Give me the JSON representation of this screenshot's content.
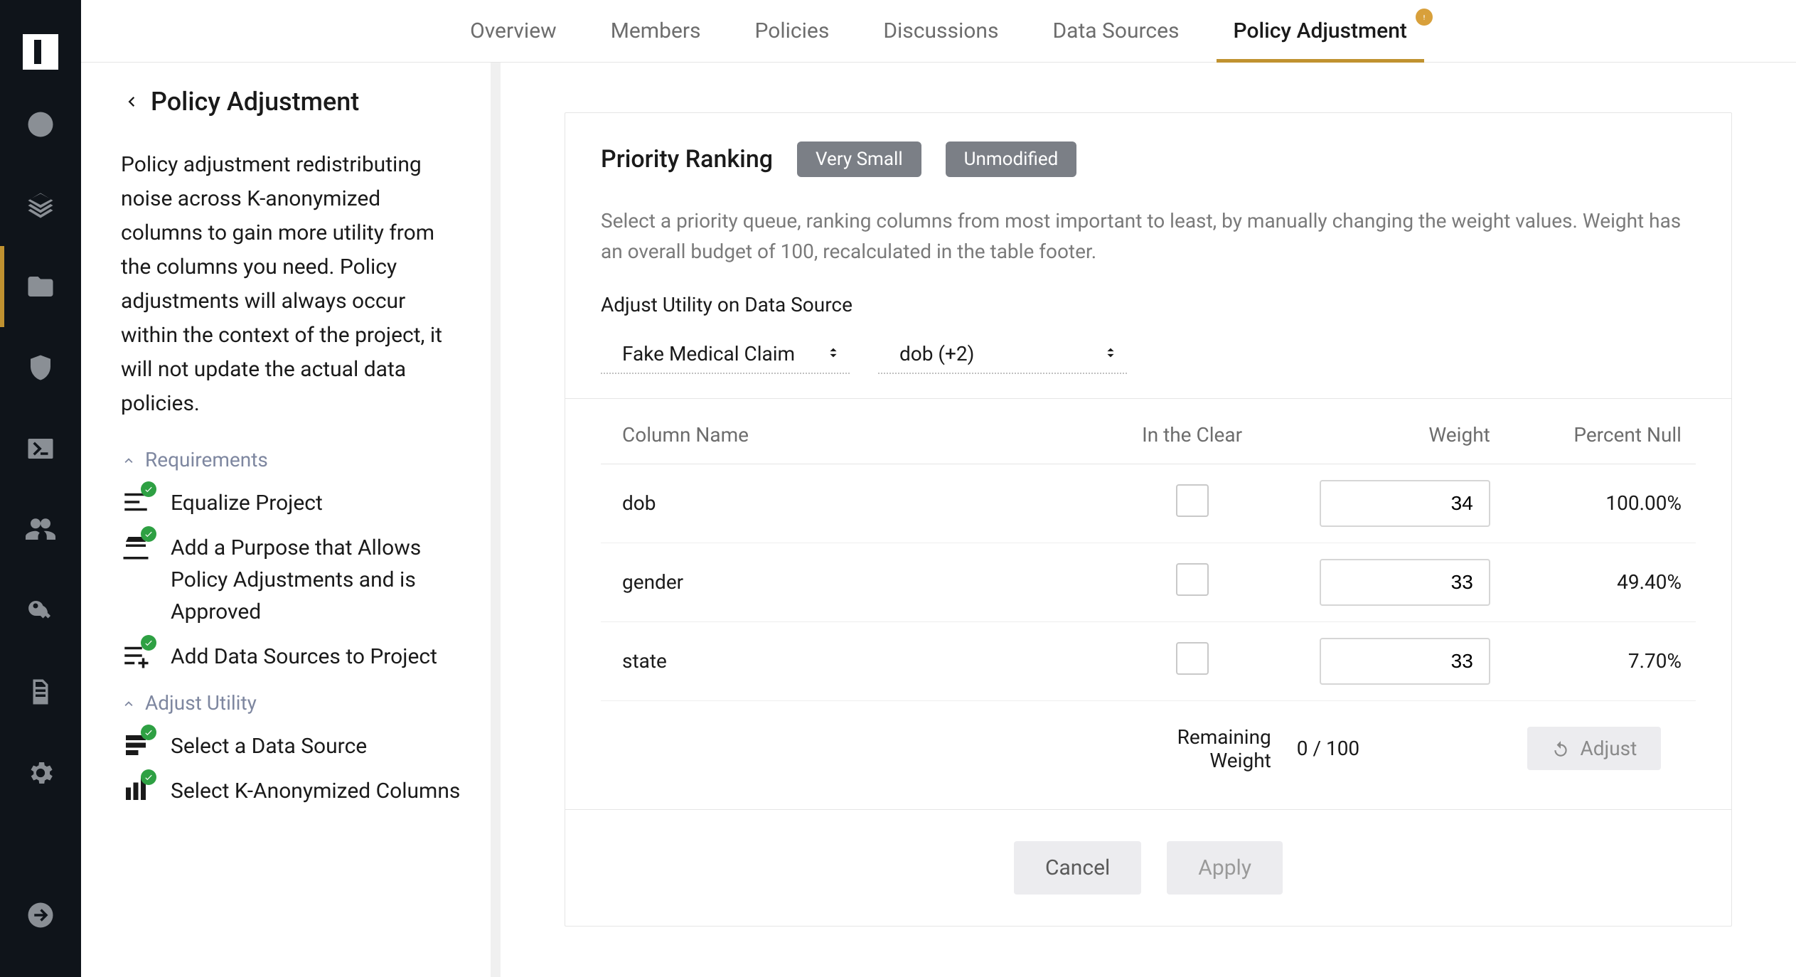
{
  "tabs": {
    "overview": "Overview",
    "members": "Members",
    "policies": "Policies",
    "discussions": "Discussions",
    "data_sources": "Data Sources",
    "policy_adjustment": "Policy Adjustment"
  },
  "sidebar": {
    "title": "Policy Adjustment",
    "description": "Policy adjustment redistributing noise across K-anonymized columns to gain more utility from the columns you need. Policy adjustments will always occur within the context of the project, it will not update the actual data policies.",
    "groups": {
      "requirements": {
        "label": "Requirements",
        "items": [
          {
            "label": "Equalize Project"
          },
          {
            "label": "Add a Purpose that Allows Policy Adjustments and is Approved"
          },
          {
            "label": "Add Data Sources to Project"
          }
        ]
      },
      "adjust_utility": {
        "label": "Adjust Utility",
        "items": [
          {
            "label": "Select a Data Source"
          },
          {
            "label": "Select K-Anonymized Columns"
          }
        ]
      }
    }
  },
  "panel": {
    "title": "Priority Ranking",
    "pill1": "Very Small",
    "pill2": "Unmodified",
    "description": "Select a priority queue, ranking columns from most important to least, by manually changing the weight values. Weight has an overall budget of 100, recalculated in the table footer.",
    "adjust_label": "Adjust Utility on Data Source",
    "selector1": "Fake Medical Claim",
    "selector2": "dob (+2)",
    "table": {
      "headers": {
        "name": "Column Name",
        "clear": "In the Clear",
        "weight": "Weight",
        "pnull": "Percent Null"
      },
      "rows": [
        {
          "name": "dob",
          "weight": "34",
          "pnull": "100.00%"
        },
        {
          "name": "gender",
          "weight": "33",
          "pnull": "49.40%"
        },
        {
          "name": "state",
          "weight": "33",
          "pnull": "7.70%"
        }
      ],
      "remaining_label": "Remaining Weight",
      "remaining_value": "0 / 100",
      "adjust_button": "Adjust"
    },
    "actions": {
      "cancel": "Cancel",
      "apply": "Apply"
    }
  }
}
